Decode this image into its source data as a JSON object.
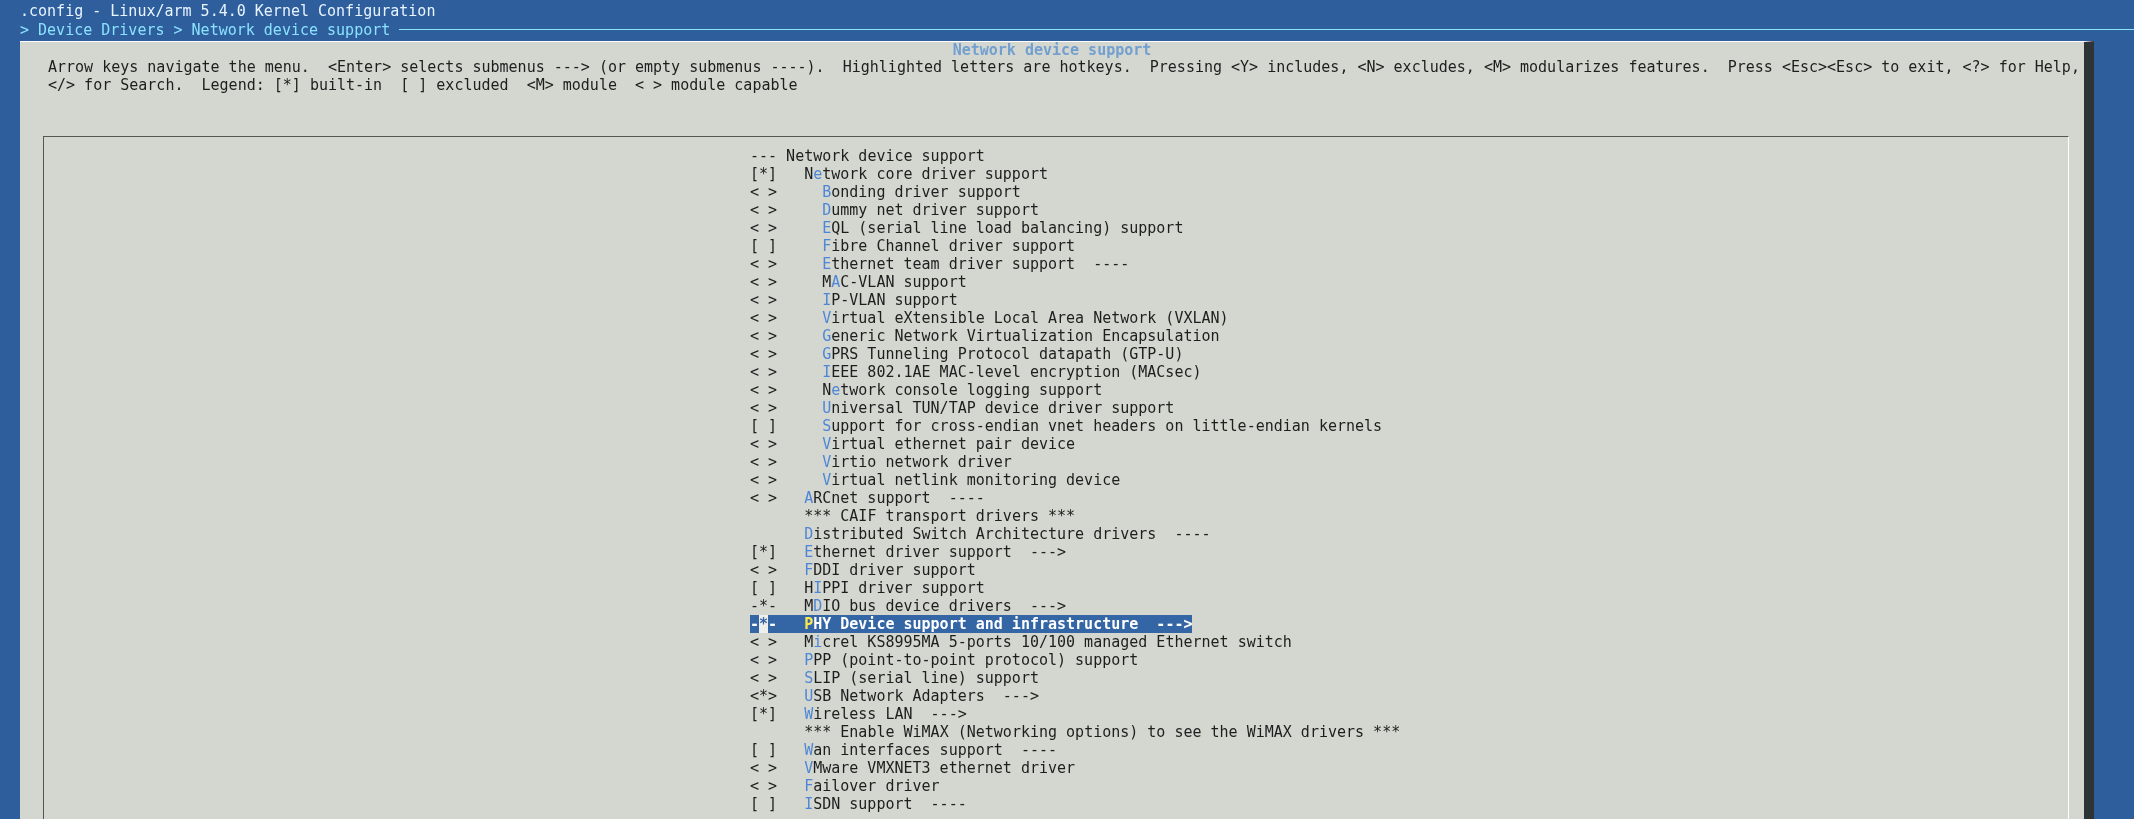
{
  "title": ".config - Linux/arm 5.4.0 Kernel Configuration",
  "breadcrumb": "> Device Drivers > Network device support",
  "dialog": {
    "title": "Network device support",
    "help": [
      "Arrow keys navigate the menu.  <Enter> selects submenus ---> (or empty submenus ----).  Highlighted letters are hotkeys.  Pressing <Y> includes, <N> excludes, <M> modularizes features.  Press <Esc><Esc> to exit, <?> for Help,",
      "</> for Search.  Legend: [*] built-in  [ ] excluded  <M> module  < > module capable"
    ]
  },
  "menu": [
    {
      "kind": "header",
      "text": "--- Network device support",
      "selected": false
    },
    {
      "kind": "option",
      "mark": "[*]",
      "pre": "N",
      "key": "e",
      "post": "twork core driver support",
      "selected": false,
      "children": [
        {
          "kind": "option",
          "mark": "< >",
          "key": "B",
          "post": "onding driver support",
          "selected": false
        },
        {
          "kind": "option",
          "mark": "< >",
          "key": "D",
          "post": "ummy net driver support",
          "selected": false
        },
        {
          "kind": "option",
          "mark": "< >",
          "key": "E",
          "post": "QL (serial line load balancing) support",
          "selected": false
        },
        {
          "kind": "option",
          "mark": "[ ]",
          "key": "F",
          "post": "ibre Channel driver support",
          "selected": false
        },
        {
          "kind": "option",
          "mark": "< >",
          "key": "E",
          "post": "thernet team driver support  ----",
          "selected": false
        },
        {
          "kind": "option",
          "mark": "< >",
          "pre": "M",
          "key": "A",
          "post": "C-VLAN support",
          "selected": false
        },
        {
          "kind": "option",
          "mark": "< >",
          "key": "I",
          "post": "P-VLAN support",
          "selected": false
        },
        {
          "kind": "option",
          "mark": "< >",
          "key": "V",
          "post": "irtual eXtensible Local Area Network (VXLAN)",
          "selected": false
        },
        {
          "kind": "option",
          "mark": "< >",
          "key": "G",
          "post": "eneric Network Virtualization Encapsulation",
          "selected": false
        },
        {
          "kind": "option",
          "mark": "< >",
          "key": "G",
          "post": "PRS Tunneling Protocol datapath (GTP-U)",
          "selected": false
        },
        {
          "kind": "option",
          "mark": "< >",
          "key": "I",
          "post": "EEE 802.1AE MAC-level encryption (MACsec)",
          "selected": false
        },
        {
          "kind": "option",
          "mark": "< >",
          "pre": "N",
          "key": "e",
          "post": "twork console logging support",
          "selected": false
        },
        {
          "kind": "option",
          "mark": "< >",
          "key": "U",
          "post": "niversal TUN/TAP device driver support",
          "selected": false
        },
        {
          "kind": "option",
          "mark": "[ ]",
          "key": "S",
          "post": "upport for cross-endian vnet headers on little-endian kernels",
          "selected": false
        },
        {
          "kind": "option",
          "mark": "< >",
          "key": "V",
          "post": "irtual ethernet pair device",
          "selected": false
        },
        {
          "kind": "option",
          "mark": "< >",
          "key": "V",
          "post": "irtio network driver",
          "selected": false
        },
        {
          "kind": "option",
          "mark": "< >",
          "key": "V",
          "post": "irtual netlink monitoring device",
          "selected": false
        }
      ]
    },
    {
      "kind": "option",
      "mark": "< >",
      "key": "A",
      "post": "RCnet support  ----",
      "selected": false
    },
    {
      "kind": "comment",
      "text": "*** CAIF transport drivers ***",
      "selected": false
    },
    {
      "kind": "option",
      "key": "D",
      "post": "istributed Switch Architecture drivers  ----",
      "selected": false
    },
    {
      "kind": "option",
      "mark": "[*]",
      "key": "E",
      "post": "thernet driver support  --->",
      "selected": false
    },
    {
      "kind": "option",
      "mark": "< >",
      "key": "F",
      "post": "DDI driver support",
      "selected": false
    },
    {
      "kind": "option",
      "mark": "[ ]",
      "pre": "H",
      "key": "I",
      "post": "PPI driver support",
      "selected": false
    },
    {
      "kind": "option",
      "mark": "-*-",
      "pre": "M",
      "key": "D",
      "post": "IO bus device drivers  --->",
      "selected": false
    },
    {
      "kind": "option",
      "mark": "-*-",
      "key": "P",
      "post": "HY Device support and infrastructure  --->",
      "selected": true
    },
    {
      "kind": "option",
      "mark": "< >",
      "pre": "M",
      "key": "i",
      "post": "crel KS8995MA 5-ports 10/100 managed Ethernet switch",
      "selected": false
    },
    {
      "kind": "option",
      "mark": "< >",
      "key": "P",
      "post": "PP (point-to-point protocol) support",
      "selected": false
    },
    {
      "kind": "option",
      "mark": "< >",
      "key": "S",
      "post": "LIP (serial line) support",
      "selected": false
    },
    {
      "kind": "option",
      "mark": "<*>",
      "key": "U",
      "post": "SB Network Adapters  --->",
      "selected": false
    },
    {
      "kind": "option",
      "mark": "[*]",
      "key": "W",
      "post": "ireless LAN  --->",
      "selected": false
    },
    {
      "kind": "comment",
      "text": "*** Enable WiMAX (Networking options) to see the WiMAX drivers ***",
      "selected": false
    },
    {
      "kind": "option",
      "mark": "[ ]",
      "key": "W",
      "post": "an interfaces support  ----",
      "selected": false
    },
    {
      "kind": "option",
      "mark": "< >",
      "key": "V",
      "post": "Mware VMXNET3 ethernet driver",
      "selected": false
    },
    {
      "kind": "option",
      "mark": "< >",
      "key": "F",
      "post": "ailover driver",
      "selected": false
    },
    {
      "kind": "option",
      "mark": "[ ]",
      "key": "I",
      "post": "SDN support  ----",
      "selected": false
    }
  ]
}
